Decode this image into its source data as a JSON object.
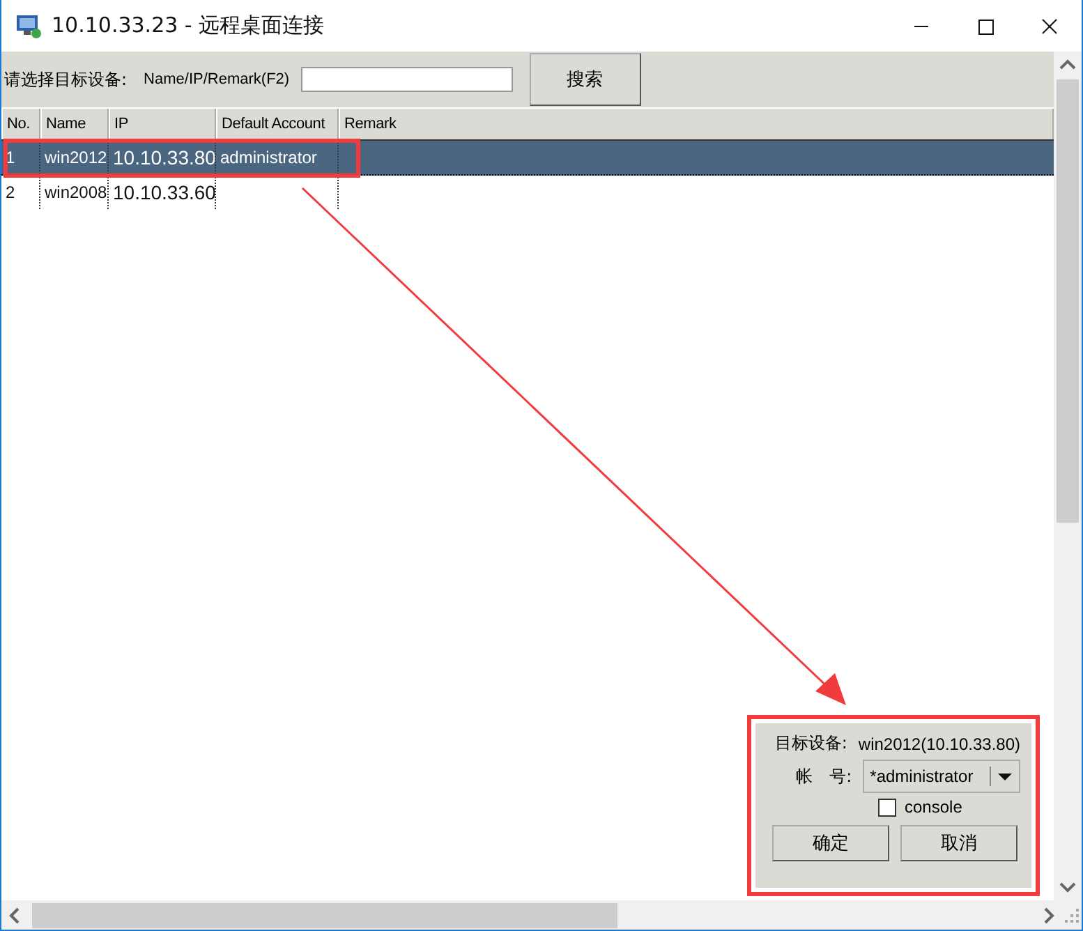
{
  "window": {
    "title": "10.10.33.23 - 远程桌面连接"
  },
  "toolbar": {
    "prompt": "请选择目标设备:",
    "search_label": "Name/IP/Remark(F2)",
    "search_button": "搜索"
  },
  "table": {
    "columns": [
      "No.",
      "Name",
      "IP",
      "Default Account",
      "Remark"
    ],
    "rows": [
      {
        "cells": [
          "1",
          "win2012",
          "10.10.33.80",
          "administrator",
          ""
        ],
        "selected": true
      },
      {
        "cells": [
          "2",
          "win2008",
          "10.10.33.60",
          "",
          ""
        ],
        "selected": false
      }
    ]
  },
  "dialog": {
    "target_label": "目标设备:",
    "target_value": "win2012(10.10.33.80)",
    "account_label": "帐　号:",
    "account_value": "*administrator",
    "console": {
      "label": "console",
      "checked": false
    },
    "buttons": [
      "确定",
      "取消"
    ]
  }
}
